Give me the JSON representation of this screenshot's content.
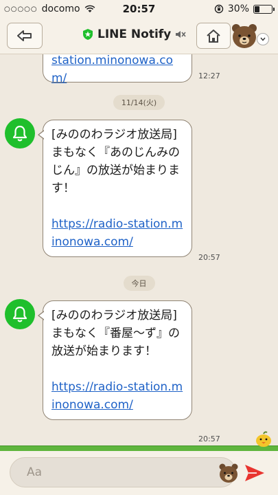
{
  "status_bar": {
    "carrier": "docomo",
    "time": "20:57",
    "battery": "30%"
  },
  "header": {
    "title": "LINE Notify"
  },
  "chat": {
    "prev_message_tail": "station.minonowa.co\nm/",
    "prev_time": "12:27",
    "date1": "11/14(火)",
    "msg1_text": "[みののわラジオ放送局] まもなく『あのじんみのじん』の放送が始まります！",
    "msg1_link": "https://radio-station.minonowa.com/",
    "msg1_time": "20:57",
    "date2": "今日",
    "msg2_text": "[みののわラジオ放送局] まもなく『番屋～ず』の放送が始まります！",
    "msg2_link": "https://radio-station.minonowa.com/",
    "msg2_time": "20:57"
  },
  "footer": {
    "input_placeholder": "Aa"
  },
  "colors": {
    "background": "#efe9df",
    "avatar_green": "#1fbf2c",
    "link": "#1f62c7",
    "send_red": "#e8342f"
  }
}
